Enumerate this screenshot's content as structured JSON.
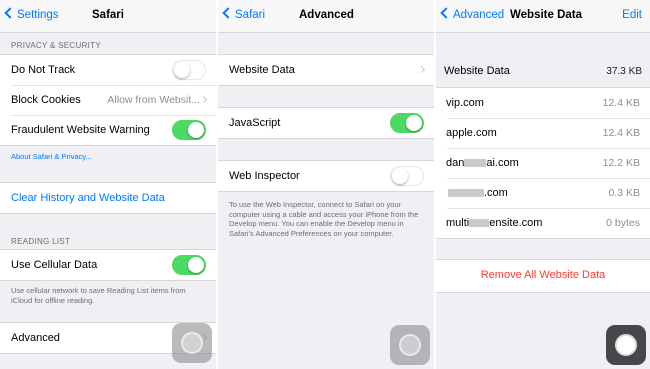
{
  "panel1": {
    "back": "Settings",
    "title": "Safari",
    "privacy_header": "PRIVACY & SECURITY",
    "rows": [
      {
        "label": "Do Not Track",
        "toggle": false
      },
      {
        "label": "Block Cookies",
        "value": "Allow from Websit..."
      },
      {
        "label": "Fraudulent Website Warning",
        "toggle": true
      }
    ],
    "about_link": "About Safari & Privacy...",
    "clear_history": "Clear History and Website Data",
    "reading_header": "READING LIST",
    "cellular_label": "Use Cellular Data",
    "cellular_toggle": true,
    "cellular_footer": "Use cellular network to save Reading List items from iCloud for offline reading.",
    "advanced": "Advanced"
  },
  "panel2": {
    "back": "Safari",
    "title": "Advanced",
    "website_data": "Website Data",
    "javascript": "JavaScript",
    "javascript_toggle": true,
    "web_inspector": "Web Inspector",
    "web_inspector_toggle": false,
    "inspector_footer": "To use the Web Inspector, connect to Safari on your computer using a cable and access your iPhone from the Develop menu. You can enable the Develop menu in Safari's Advanced Preferences on your computer."
  },
  "panel3": {
    "back": "Advanced",
    "title": "Website Data",
    "edit": "Edit",
    "header_label": "Website Data",
    "header_value": "37.3 KB",
    "sites": [
      {
        "pre": "vip.com",
        "post": "",
        "size": "12.4 KB"
      },
      {
        "pre": "apple.com",
        "post": "",
        "size": "12.4 KB"
      },
      {
        "pre": "dan",
        "post": "ai.com",
        "size": "12.2 KB"
      },
      {
        "pre": "",
        "post": ".com",
        "size": "0.3 KB"
      },
      {
        "pre": "multi",
        "post": "ensite.com",
        "size": "0 bytes"
      }
    ],
    "remove_all": "Remove All Website Data"
  },
  "colors": {
    "accent": "#007aff",
    "toggle_on": "#4cd964",
    "destructive": "#ff3b30"
  }
}
